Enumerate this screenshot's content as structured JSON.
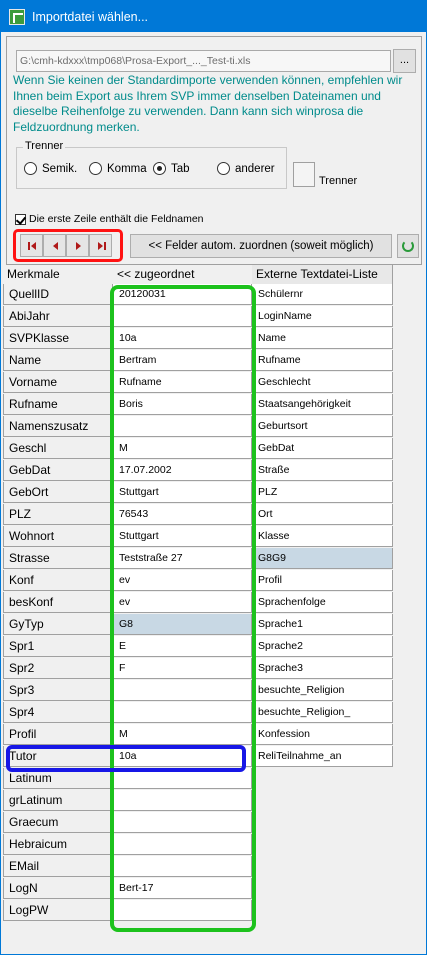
{
  "window": {
    "title": "Importdatei wählen...",
    "icon": "app-icon"
  },
  "file": {
    "path": "G:\\cmh-kdxxx\\tmp068\\Prosa-Export_..._Test-ti.xls",
    "browse_label": "..."
  },
  "info_text": "Wenn Sie keinen der Standardimporte verwenden können, empfehlen wir Ihnen beim Export aus Ihrem SVP immer denselben Dateinamen und dieselbe Reihenfolge zu verwenden. Dann kann sich winprosa die Feldzuordnung merken.",
  "trenner": {
    "legend": "Trenner",
    "options": [
      "Semik.",
      "Komma",
      "Tab",
      "anderer"
    ],
    "selected": "Tab",
    "custom_label": "Trenner"
  },
  "header_row_check": {
    "label": "Die erste Zeile enthält die Feldnamen",
    "checked": true
  },
  "nav": {
    "buttons": [
      "first",
      "prev",
      "next",
      "last"
    ]
  },
  "auto_button_label": "<< Felder autom. zuordnen (soweit möglich)",
  "grid": {
    "headers": [
      "Merkmale",
      "<< zugeordnet",
      "Externe Textdatei-Liste"
    ],
    "rows": [
      {
        "merkmal": "QuellID",
        "zugeordnet": "20120031",
        "extern": "Schülernr"
      },
      {
        "merkmal": "AbiJahr",
        "zugeordnet": "",
        "extern": "LoginName"
      },
      {
        "merkmal": "SVPKlasse",
        "zugeordnet": "10a",
        "extern": "Name"
      },
      {
        "merkmal": "Name",
        "zugeordnet": "Bertram",
        "extern": "Rufname"
      },
      {
        "merkmal": "Vorname",
        "zugeordnet": "Rufname",
        "extern": "Geschlecht"
      },
      {
        "merkmal": "Rufname",
        "zugeordnet": "Boris",
        "extern": "Staatsangehörigkeit"
      },
      {
        "merkmal": "Namenszusatz",
        "zugeordnet": "",
        "extern": "Geburtsort"
      },
      {
        "merkmal": "Geschl",
        "zugeordnet": "M",
        "extern": "GebDat"
      },
      {
        "merkmal": "GebDat",
        "zugeordnet": "17.07.2002",
        "extern": "Straße"
      },
      {
        "merkmal": "GebOrt",
        "zugeordnet": "Stuttgart",
        "extern": "PLZ"
      },
      {
        "merkmal": "PLZ",
        "zugeordnet": "76543",
        "extern": "Ort"
      },
      {
        "merkmal": "Wohnort",
        "zugeordnet": "Stuttgart",
        "extern": "Klasse"
      },
      {
        "merkmal": "Strasse",
        "zugeordnet": "Teststraße 27",
        "extern": "G8G9"
      },
      {
        "merkmal": "Konf",
        "zugeordnet": "ev",
        "extern": "Profil"
      },
      {
        "merkmal": "besKonf",
        "zugeordnet": "ev",
        "extern": "Sprachenfolge"
      },
      {
        "merkmal": "GyTyp",
        "zugeordnet": "G8",
        "extern": "Sprache1"
      },
      {
        "merkmal": "Spr1",
        "zugeordnet": "E",
        "extern": "Sprache2"
      },
      {
        "merkmal": "Spr2",
        "zugeordnet": "F",
        "extern": "Sprache3"
      },
      {
        "merkmal": "Spr3",
        "zugeordnet": "",
        "extern": "besuchte_Religion"
      },
      {
        "merkmal": "Spr4",
        "zugeordnet": "",
        "extern": "besuchte_Religion_"
      },
      {
        "merkmal": "Profil",
        "zugeordnet": "M",
        "extern": "Konfession"
      },
      {
        "merkmal": "Tutor",
        "zugeordnet": "10a",
        "extern": "ReliTeilnahme_an"
      },
      {
        "merkmal": "Latinum",
        "zugeordnet": "",
        "extern": ""
      },
      {
        "merkmal": "grLatinum",
        "zugeordnet": "",
        "extern": ""
      },
      {
        "merkmal": "Graecum",
        "zugeordnet": "",
        "extern": ""
      },
      {
        "merkmal": "Hebraicum",
        "zugeordnet": "",
        "extern": ""
      },
      {
        "merkmal": "EMail",
        "zugeordnet": "",
        "extern": ""
      },
      {
        "merkmal": "LogN",
        "zugeordnet": "Bert-17",
        "extern": ""
      },
      {
        "merkmal": "LogPW",
        "zugeordnet": "",
        "extern": ""
      }
    ],
    "selected_zugeordnet_row": "GyTyp",
    "selected_extern_row": "Strasse",
    "extern_row_count": 22
  },
  "annotation_colors": {
    "nav_highlight": "#ff1212",
    "assigned_column_highlight": "#1dc21d",
    "tutor_row_highlight": "#1717e6"
  }
}
